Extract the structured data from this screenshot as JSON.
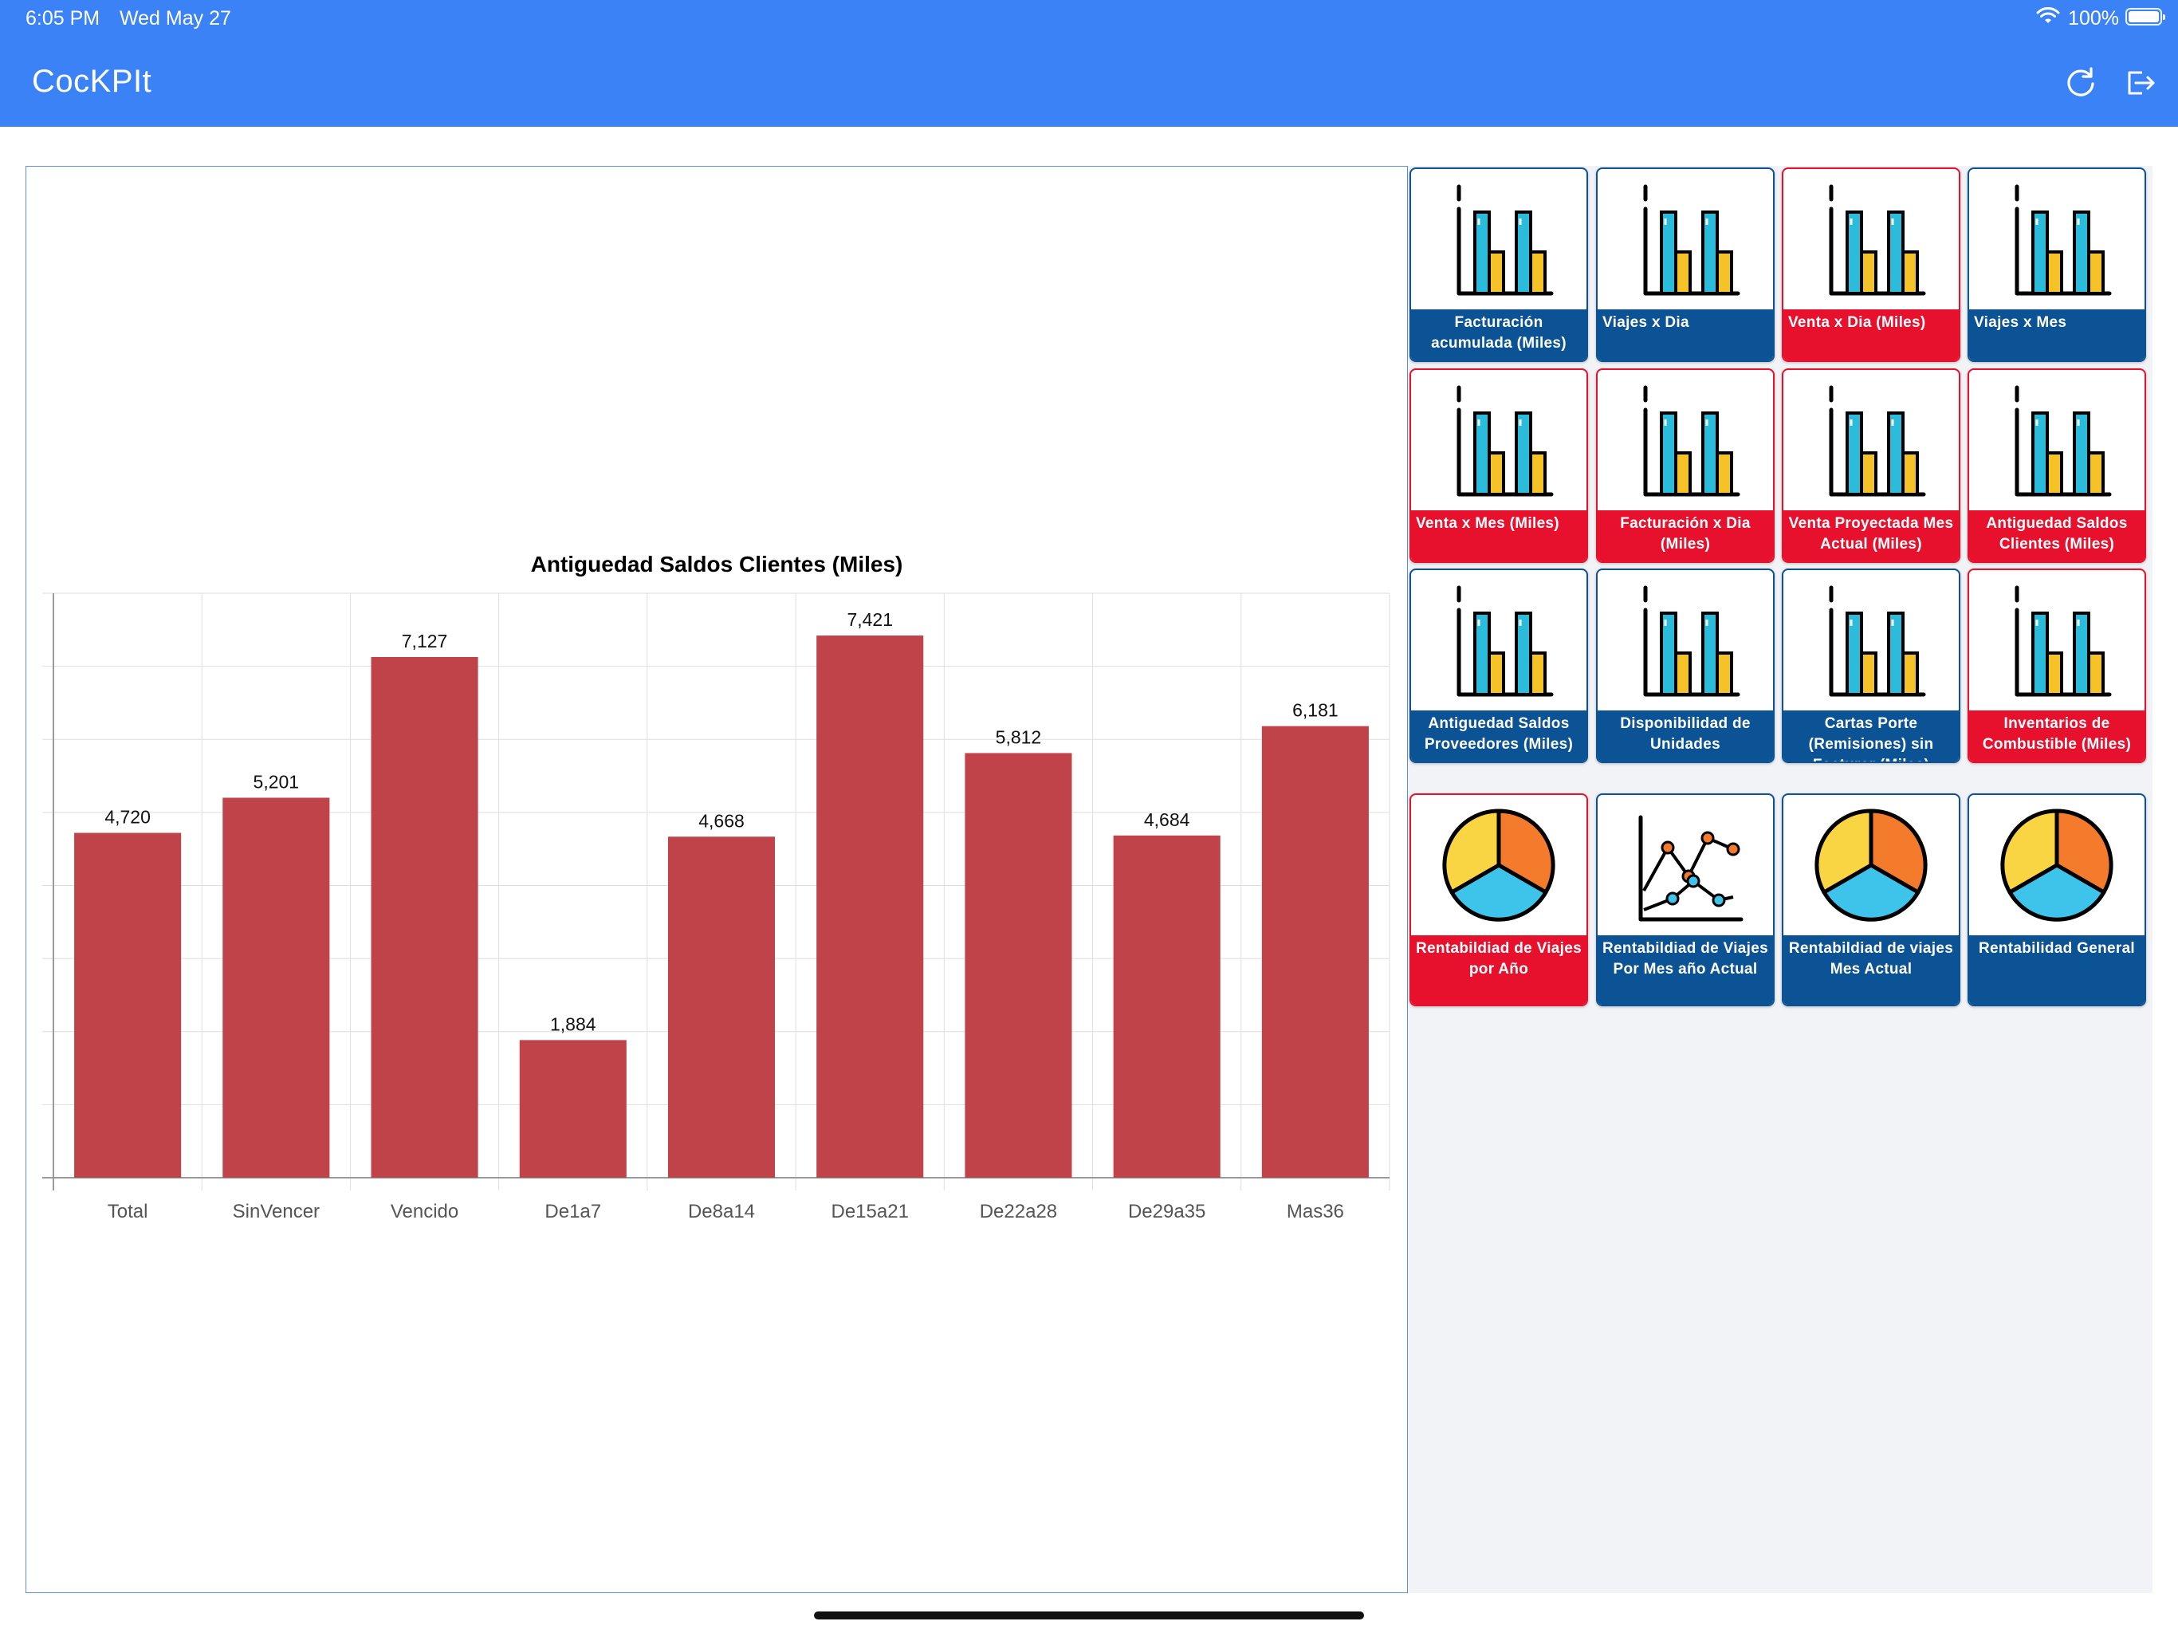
{
  "status_bar": {
    "time": "6:05 PM",
    "date": "Wed May 27",
    "battery": "100%",
    "icons": [
      "wifi-icon",
      "battery-icon"
    ]
  },
  "header": {
    "title": "CocKPIt",
    "actions": [
      {
        "name": "refresh",
        "icon": "refresh-icon"
      },
      {
        "name": "logout",
        "icon": "logout-icon"
      }
    ]
  },
  "colors": {
    "header_bg": "#3b82f6",
    "bar": "#c0434a",
    "tile_blue": "#0b5394",
    "tile_red": "#e8112d"
  },
  "chart_data": {
    "type": "bar",
    "title": "Antiguedad Saldos Clientes (Miles)",
    "categories": [
      "Total",
      "SinVencer",
      "Vencido",
      "De1a7",
      "De8a14",
      "De15a21",
      "De22a28",
      "De29a35",
      "Mas36"
    ],
    "values": [
      4720,
      5201,
      7127,
      1884,
      4668,
      7421,
      5812,
      4684,
      6181
    ],
    "value_labels": [
      "4,720",
      "5,201",
      "7,127",
      "1,884",
      "4,668",
      "7,421",
      "5,812",
      "4,684",
      "6,181"
    ],
    "ylim": [
      0,
      8000
    ],
    "grid": true,
    "xlabel": "",
    "ylabel": ""
  },
  "tiles": [
    {
      "label": "Facturación acumulada (Miles)",
      "color": "blue",
      "icon": "bar-chart-icon"
    },
    {
      "label": "Viajes x Dia",
      "color": "blue",
      "icon": "bar-chart-icon"
    },
    {
      "label": "Venta x Dia (Miles)",
      "color": "red",
      "icon": "bar-chart-icon"
    },
    {
      "label": "Viajes x Mes",
      "color": "blue",
      "icon": "bar-chart-icon"
    },
    {
      "label": "Venta x Mes (Miles)",
      "color": "red",
      "icon": "bar-chart-icon"
    },
    {
      "label": "Facturación x Dia (Miles)",
      "color": "red",
      "icon": "bar-chart-icon"
    },
    {
      "label": "Venta Proyectada Mes Actual (Miles)",
      "color": "red",
      "icon": "bar-chart-icon"
    },
    {
      "label": "Antiguedad Saldos Clientes (Miles)",
      "color": "red",
      "icon": "bar-chart-icon"
    },
    {
      "label": "Antiguedad Saldos Proveedores (Miles)",
      "color": "blue",
      "icon": "bar-chart-icon"
    },
    {
      "label": "Disponibilidad de Unidades",
      "color": "blue",
      "icon": "bar-chart-icon"
    },
    {
      "label": "Cartas Porte (Remisiones) sin Facturar (Miles)",
      "color": "blue",
      "icon": "bar-chart-icon"
    },
    {
      "label": "Inventarios de Combustible (Miles)",
      "color": "red",
      "icon": "bar-chart-icon"
    },
    {
      "label": "Rentabildiad de Viajes por Año",
      "color": "red",
      "icon": "pie-chart-icon"
    },
    {
      "label": "Rentabildiad de Viajes Por Mes año Actual",
      "color": "blue",
      "icon": "line-chart-icon"
    },
    {
      "label": "Rentabildiad de viajes Mes Actual",
      "color": "blue",
      "icon": "pie-chart-icon"
    },
    {
      "label": "Rentabilidad General",
      "color": "blue",
      "icon": "pie-chart-icon"
    }
  ]
}
